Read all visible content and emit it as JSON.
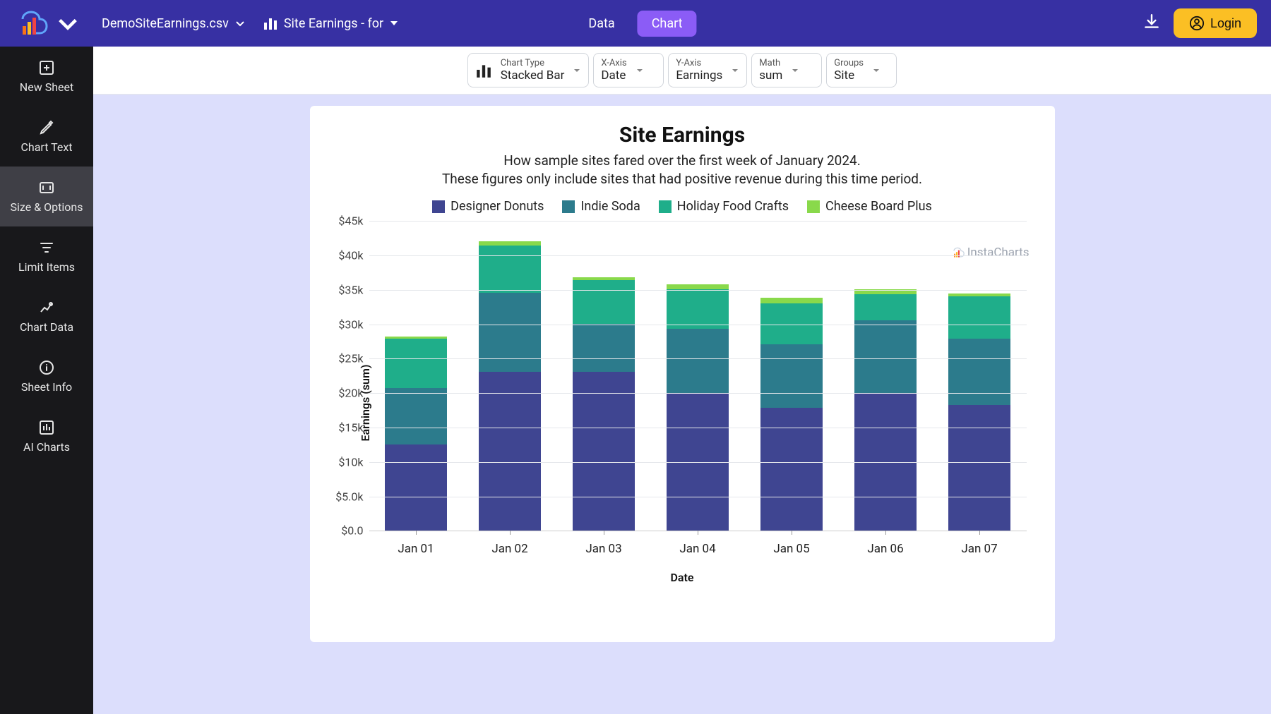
{
  "topbar": {
    "file_name": "DemoSiteEarnings.csv",
    "sheet_label": "Site Earnings - for",
    "tabs": {
      "data": "Data",
      "chart": "Chart"
    },
    "login": "Login"
  },
  "sidebar": {
    "items": [
      {
        "label": "New Sheet"
      },
      {
        "label": "Chart Text"
      },
      {
        "label": "Size & Options"
      },
      {
        "label": "Limit Items"
      },
      {
        "label": "Chart Data"
      },
      {
        "label": "Sheet Info"
      },
      {
        "label": "AI Charts"
      }
    ]
  },
  "controls": {
    "chart_type": {
      "label": "Chart Type",
      "value": "Stacked Bar"
    },
    "x_axis": {
      "label": "X-Axis",
      "value": "Date"
    },
    "y_axis": {
      "label": "Y-Axis",
      "value": "Earnings"
    },
    "math": {
      "label": "Math",
      "value": "sum"
    },
    "groups": {
      "label": "Groups",
      "value": "Site"
    }
  },
  "watermark": "InstaCharts",
  "chart_data": {
    "type": "bar",
    "stacked": true,
    "title": "Site Earnings",
    "subtitle": "How sample sites fared over the first week of January 2024.\nThese figures only include sites that had positive revenue during this time period.",
    "xlabel": "Date",
    "ylabel": "Earnings (sum)",
    "categories": [
      "Jan 01",
      "Jan 02",
      "Jan 03",
      "Jan 04",
      "Jan 05",
      "Jan 06",
      "Jan 07"
    ],
    "series": [
      {
        "name": "Designer Donuts",
        "color": "#3f4591",
        "values": [
          12500,
          23000,
          23000,
          20000,
          17800,
          20000,
          18200
        ]
      },
      {
        "name": "Indie Soda",
        "color": "#2c7b8c",
        "values": [
          8200,
          11500,
          7000,
          9300,
          9200,
          10500,
          9600
        ]
      },
      {
        "name": "Holiday Food Crafts",
        "color": "#1fae8a",
        "values": [
          7200,
          6800,
          6300,
          5700,
          6000,
          3800,
          6200
        ]
      },
      {
        "name": "Cheese Board Plus",
        "color": "#89d94b",
        "values": [
          300,
          700,
          500,
          700,
          800,
          700,
          400
        ]
      }
    ],
    "ylim": [
      0,
      45000
    ],
    "y_ticks": [
      0,
      5000,
      10000,
      15000,
      20000,
      25000,
      30000,
      35000,
      40000,
      45000
    ],
    "y_tick_labels": [
      "$0.0",
      "$5.0k",
      "$10k",
      "$15k",
      "$20k",
      "$25k",
      "$30k",
      "$35k",
      "$40k",
      "$45k"
    ]
  }
}
